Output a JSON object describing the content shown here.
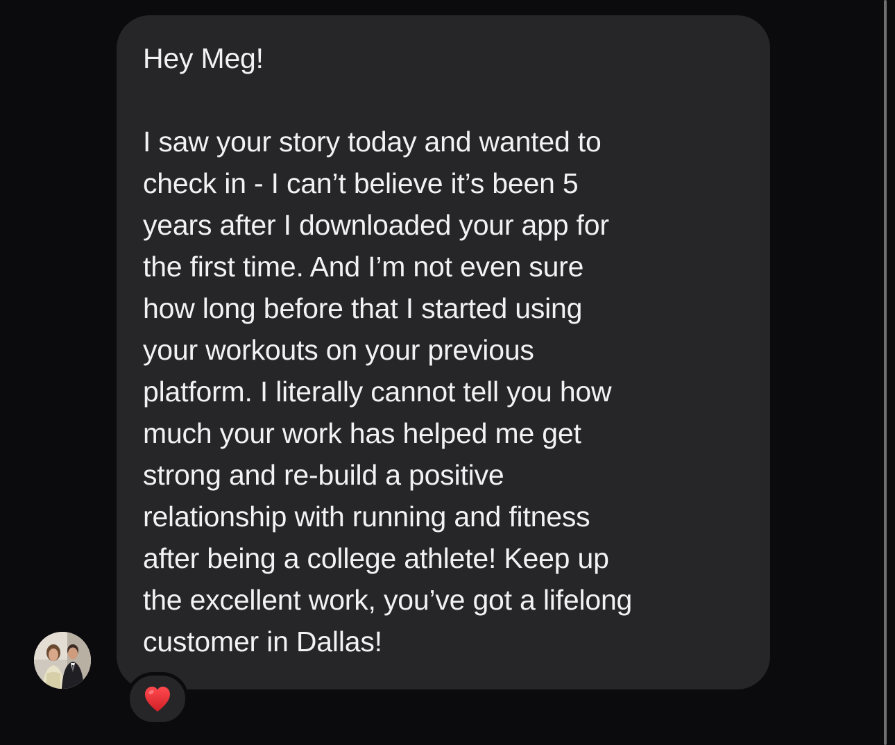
{
  "message": {
    "lines": [
      "Hey Meg!",
      "",
      "I saw your story today and wanted to",
      "check in - I can’t believe it’s been 5",
      "years after I downloaded your app for",
      "the first time. And I’m not even sure",
      "how long before that I started using",
      "your workouts on your previous",
      "platform. I literally cannot tell you how",
      "much your work has helped me get",
      "strong and re-build a positive",
      "relationship with running and fitness",
      "after being a college athlete! Keep up",
      "the excellent work, you’ve got a lifelong",
      "customer in Dallas!"
    ]
  },
  "sender": {
    "avatar_icon": "user-avatar-photo"
  },
  "reaction": {
    "icon": "red-heart-icon",
    "color": "#e0282e"
  },
  "colors": {
    "background": "#0b0b0d",
    "bubble": "#262629",
    "text": "#f2f2f4"
  }
}
